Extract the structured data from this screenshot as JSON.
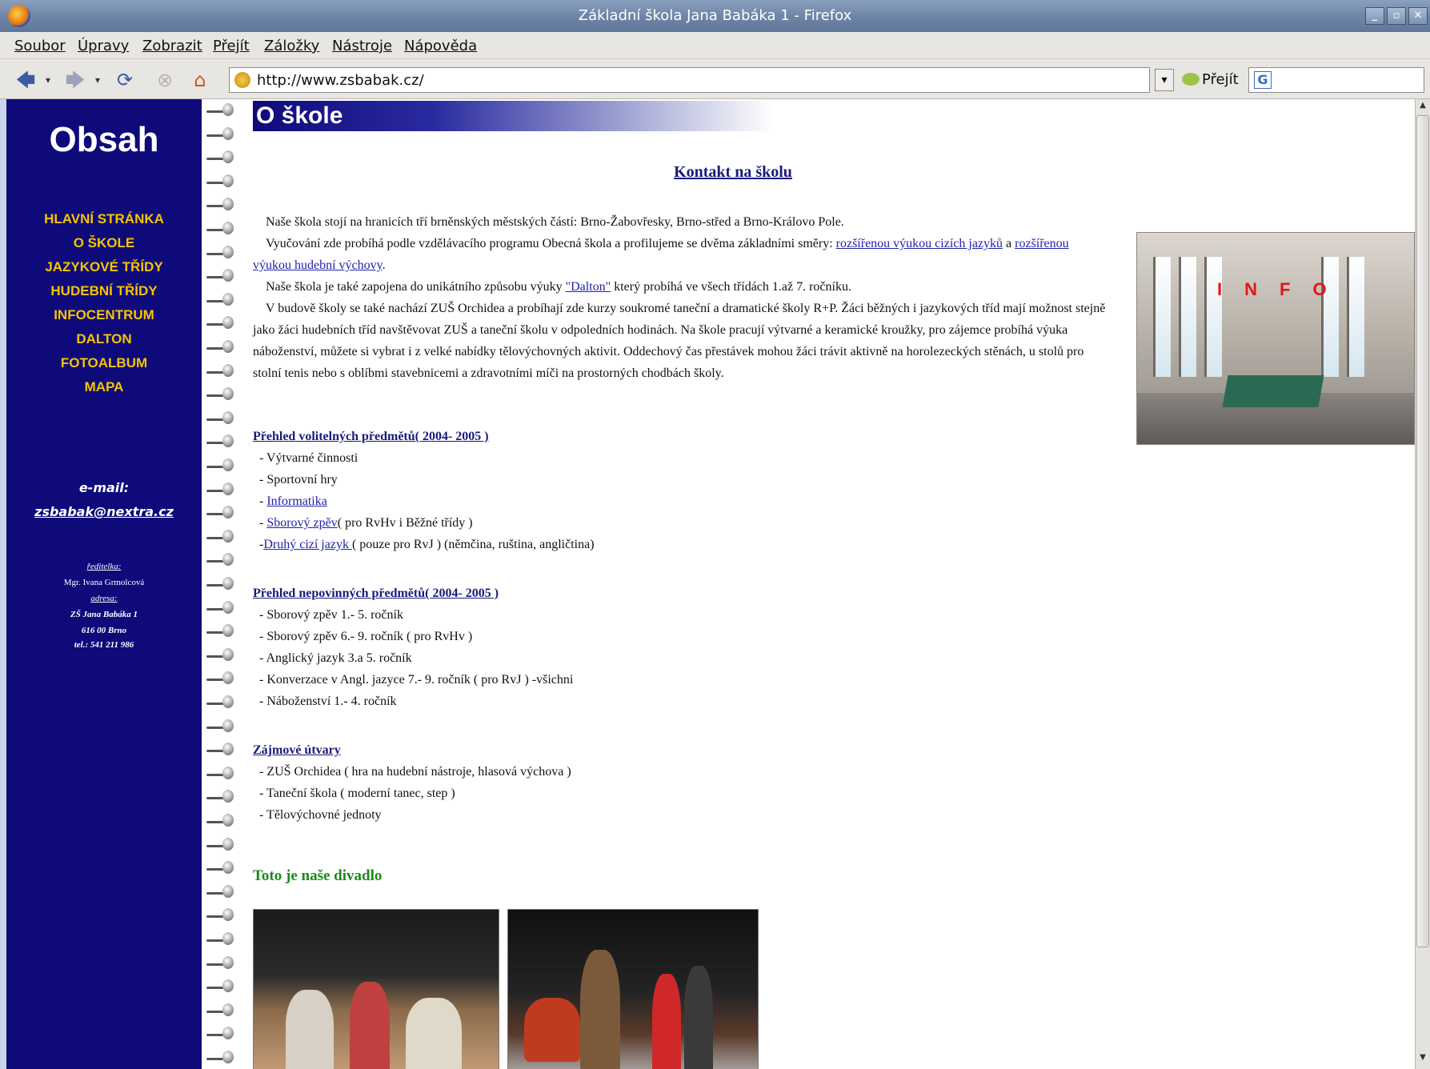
{
  "window": {
    "title": "Základní škola Jana Babáka 1 - Firefox",
    "controls": [
      "minimize",
      "maximize",
      "close"
    ]
  },
  "menu": {
    "items": [
      {
        "label": "Soubor"
      },
      {
        "label": "Úpravy"
      },
      {
        "label": "Zobrazit"
      },
      {
        "label": "Přejít"
      },
      {
        "label": "Záložky"
      },
      {
        "label": "Nástroje"
      },
      {
        "label": "Nápověda"
      }
    ]
  },
  "toolbar": {
    "url": "http://www.zsbabak.cz/",
    "go_label": "Přejít",
    "icons": [
      "back-icon",
      "forward-icon",
      "reload-icon",
      "stop-icon",
      "home-icon"
    ]
  },
  "sidebar": {
    "heading": "Obsah",
    "nav": [
      {
        "label": "HLAVNÍ STRÁNKA"
      },
      {
        "label": "O ŠKOLE"
      },
      {
        "label": "JAZYKOVÉ TŘÍDY"
      },
      {
        "label": "HUDEBNÍ TŘÍDY"
      },
      {
        "label": "INFOCENTRUM"
      },
      {
        "label": "DALTON"
      },
      {
        "label": "FOTOALBUM"
      },
      {
        "label": "MAPA"
      }
    ],
    "email_label": "e-mail:",
    "email": "zsbabak@nextra.cz",
    "director_label": "ředitelka:",
    "director_name": "Mgr. Ivana Grmolcová",
    "address_label": "adresa:",
    "address_line1": "ZŠ Jana Babáka 1",
    "address_line2": "616 00 Brno",
    "phone": "tel.: 541 211 986"
  },
  "main": {
    "title": "O škole",
    "contact_link": "Kontakt na školu",
    "p1": "Naše škola stojí na hranicích tří brněnských městských částí: Brno-Žabovřesky, Brno-střed a Brno-Královo Pole.",
    "p2_a": "Vyučování zde probíhá podle vzdělávacího programu Obecná škola a profilujeme se dvěma základními směry:",
    "p2_link1": "rozšířenou výukou cizích jazyků",
    "p2_and": "a",
    "p2_link2": "rozšířenou výukou hudební výchovy",
    "p3_a": "Naše škola je také zapojena do unikátního způsobu výuky",
    "p3_link": "\"Dalton\"",
    "p3_b": "který probíhá ve všech třídách 1.až 7. ročníku.",
    "p4": "V budově školy se také nachází ZUŠ Orchidea a probíhají zde kurzy soukromé taneční a dramatické školy R+P. Žáci běžných i jazykových tříd mají možnost stejně jako žáci hudebních tříd navštěvovat ZUŠ a taneční školu v odpoledních hodinách. Na škole pracují výtvarné a keramické kroužky, pro zájemce probíhá výuka náboženství, můžete si vybrat i z velké nabídky tělovýchovných aktivit. Oddechový čas přestávek mohou žáci trávit aktivně na horolezeckých stěnách, u stolů pro stolní tenis nebo s oblíbmi stavebnicemi a zdravotními míči na prostorných chodbách školy.",
    "photo_sign": "INFO",
    "sec1": {
      "heading": "Přehled volitelných předmětů( 2004- 2005 )",
      "items": [
        {
          "prefix": "- ",
          "text": "Výtvarné činnosti",
          "link": "",
          "suffix": ""
        },
        {
          "prefix": "- ",
          "text": "Sportovní hry",
          "link": "",
          "suffix": ""
        },
        {
          "prefix": "- ",
          "text": "",
          "link": "Informatika",
          "suffix": ""
        },
        {
          "prefix": "- ",
          "text": "",
          "link": "Sborový zpěv",
          "suffix": "( pro RvHv i Běžné třídy )"
        },
        {
          "prefix": "-",
          "text": "",
          "link": "Druhý cizí jazyk ",
          "suffix": "( pouze pro RvJ ) (němčina, ruština, angličtina)"
        }
      ]
    },
    "sec2": {
      "heading": "Přehled nepovinných předmětů( 2004- 2005 )",
      "items": [
        "- Sborový zpěv 1.- 5. ročník",
        "- Sborový zpěv 6.- 9. ročník ( pro RvHv )",
        "- Anglický jazyk 3.a 5. ročník",
        "- Konverzace v Angl. jazyce 7.- 9. ročník ( pro RvJ ) -všichni",
        "- Náboženství 1.- 4. ročník"
      ]
    },
    "sec3": {
      "heading": "Zájmové útvary",
      "items": [
        "- ZUŠ Orchidea ( hra na hudební nástroje, hlasová výchova )",
        "- Taneční škola ( moderní tanec, step )",
        "- Tělovýchovné jednoty"
      ]
    },
    "theatre_heading": "Toto je naše divadlo"
  },
  "colors": {
    "sidebar_bg": "#0e0a7a",
    "nav_text": "#f6c400",
    "link": "#2222aa",
    "theatre_heading": "#1a8a1a"
  }
}
